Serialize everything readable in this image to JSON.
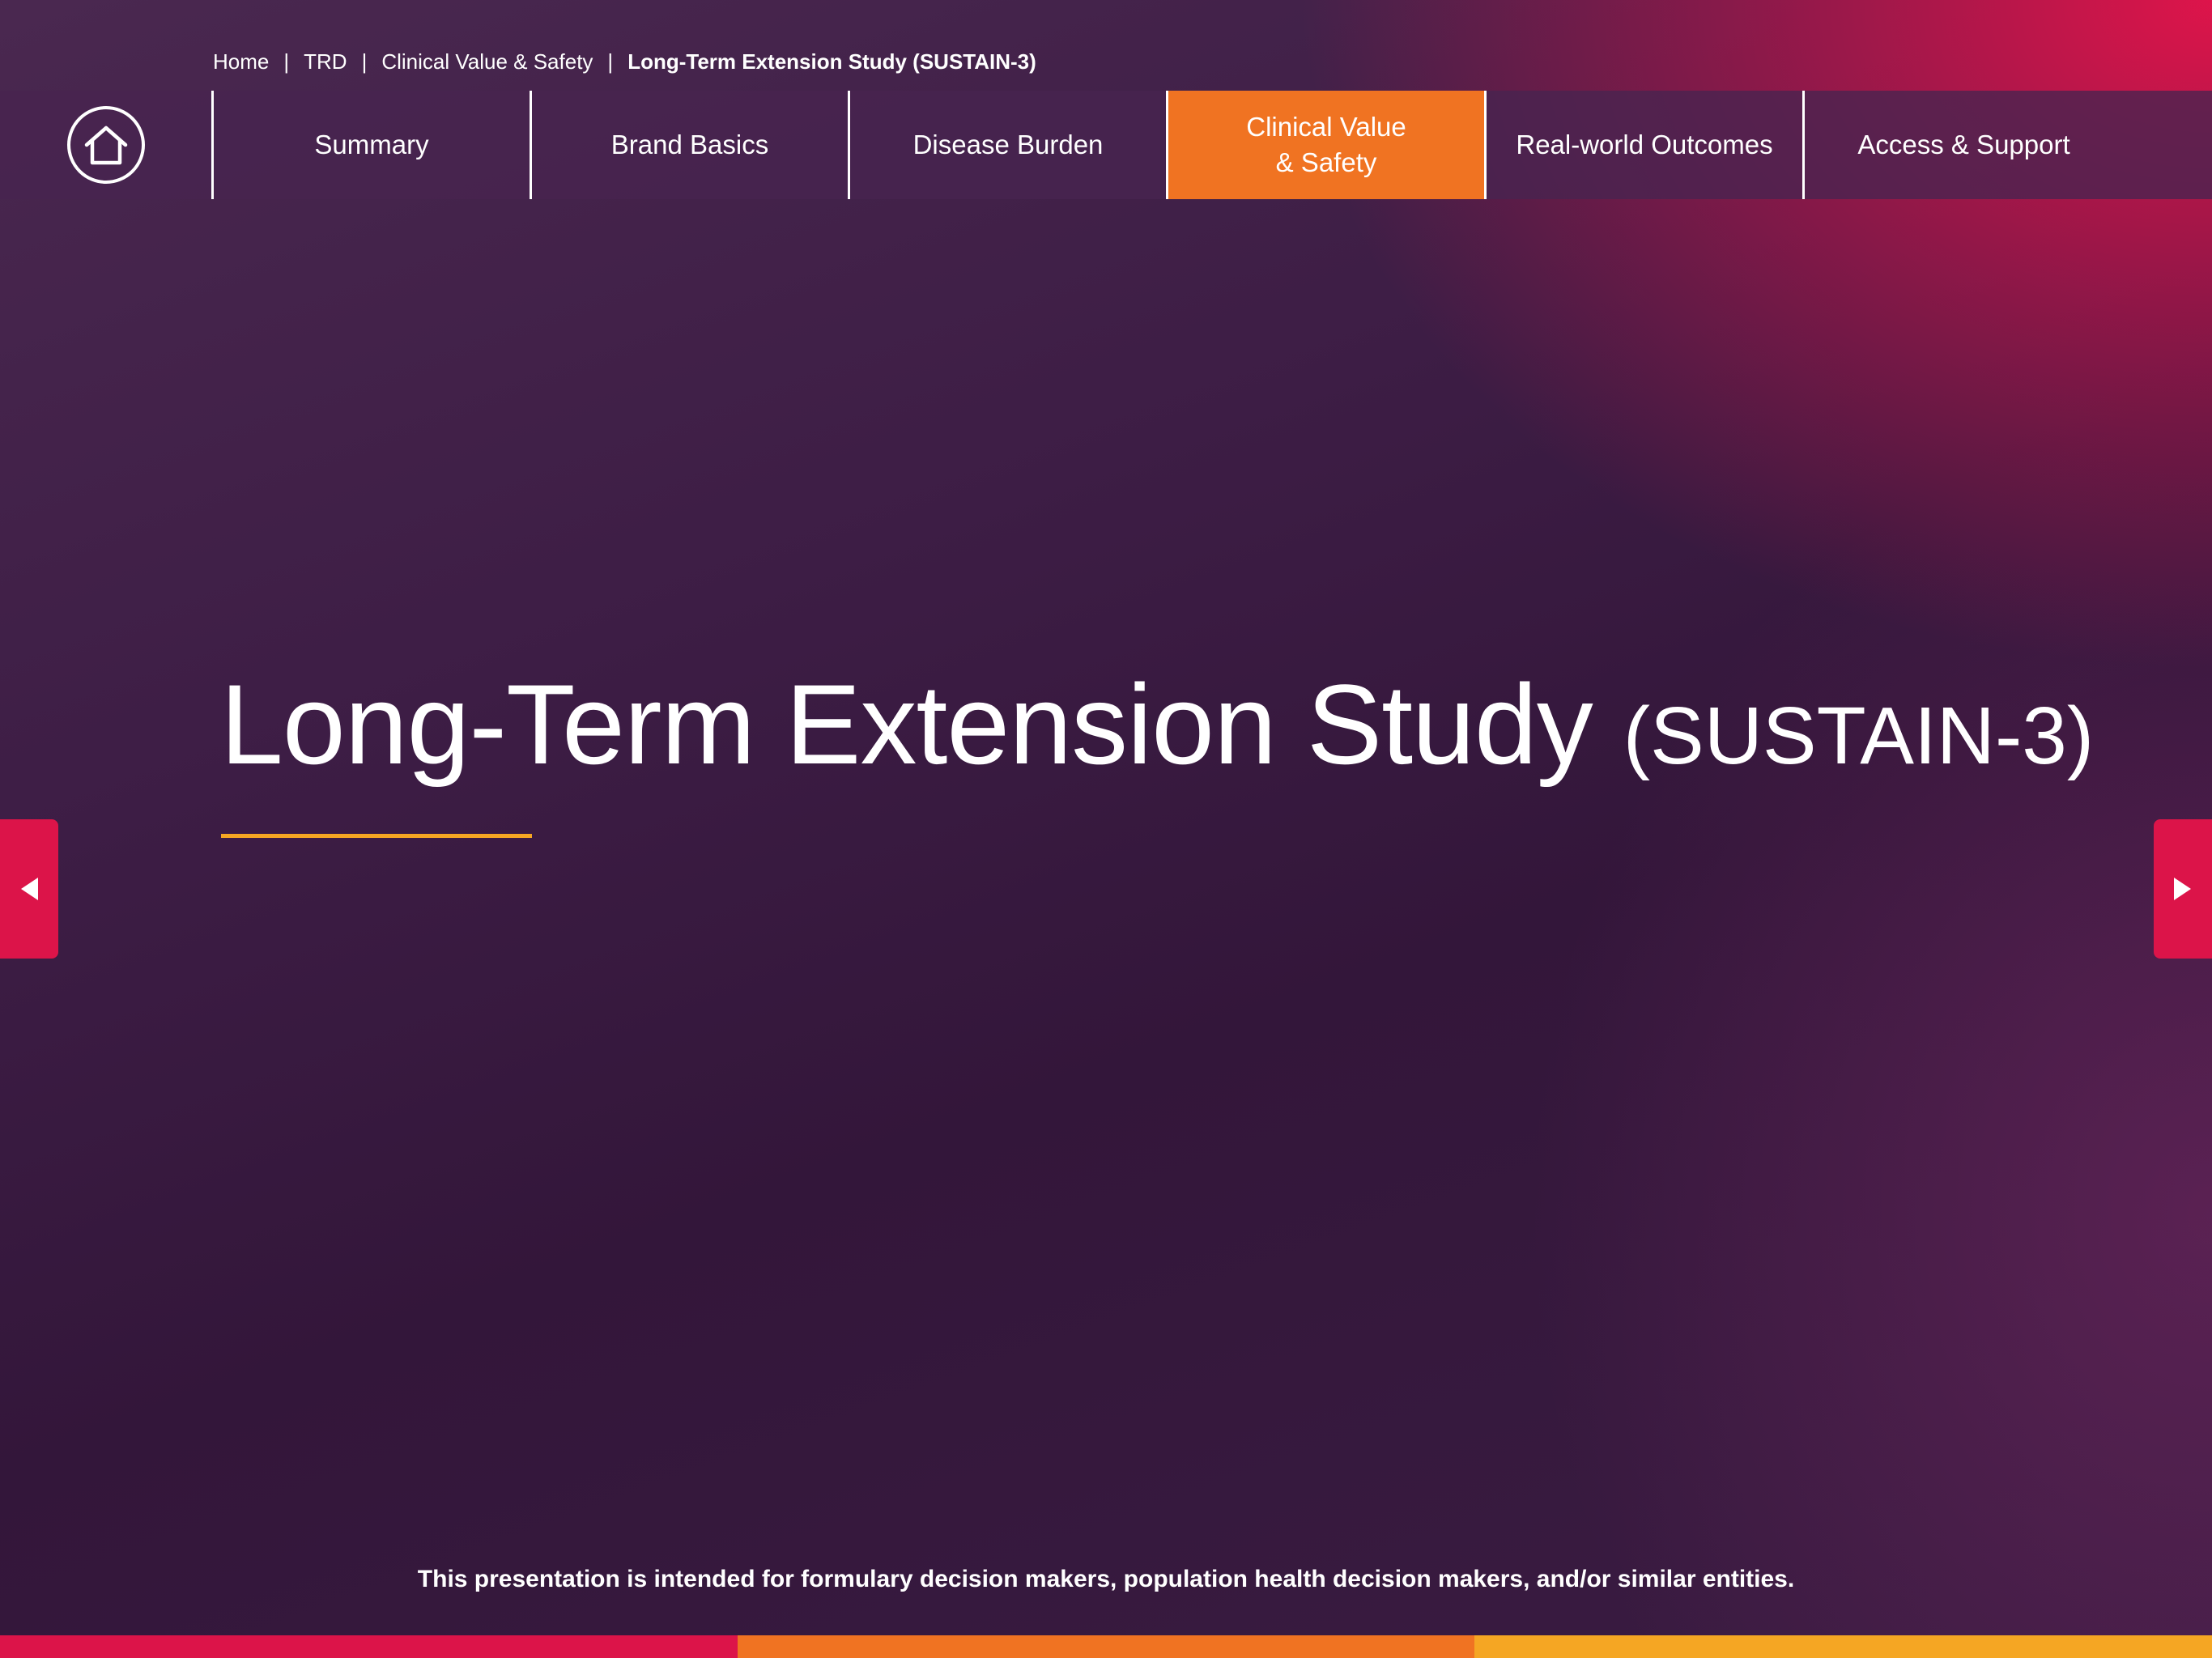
{
  "breadcrumb": {
    "items": [
      "Home",
      "TRD",
      "Clinical Value & Safety"
    ],
    "current": "Long-Term Extension Study (SUSTAIN-3)",
    "separator": "|"
  },
  "nav": {
    "home_icon": "home-icon",
    "tabs": [
      {
        "line1": "Summary",
        "line2": ""
      },
      {
        "line1": "Brand Basics",
        "line2": ""
      },
      {
        "line1": "Disease Burden",
        "line2": ""
      },
      {
        "line1": "Clinical Value",
        "line2": "& Safety",
        "active": true
      },
      {
        "line1": "Real-world Outcomes",
        "line2": ""
      },
      {
        "line1": "Access & Support",
        "line2": ""
      }
    ]
  },
  "page": {
    "title": "Long-Term Extension Study",
    "title_sub": "(SUSTAIN-3)"
  },
  "arrows": {
    "prev_icon": "triangle-left-icon",
    "next_icon": "triangle-right-icon"
  },
  "footer": {
    "disclaimer": "This presentation is intended for formulary decision makers, population health decision makers, and/or similar entities."
  },
  "colors": {
    "accent_orange": "#f07322",
    "accent_red": "#dc1449",
    "rule_gold": "#f5a623",
    "bottom_bar": [
      "#dc1449",
      "#f07322",
      "#f5a623"
    ]
  }
}
